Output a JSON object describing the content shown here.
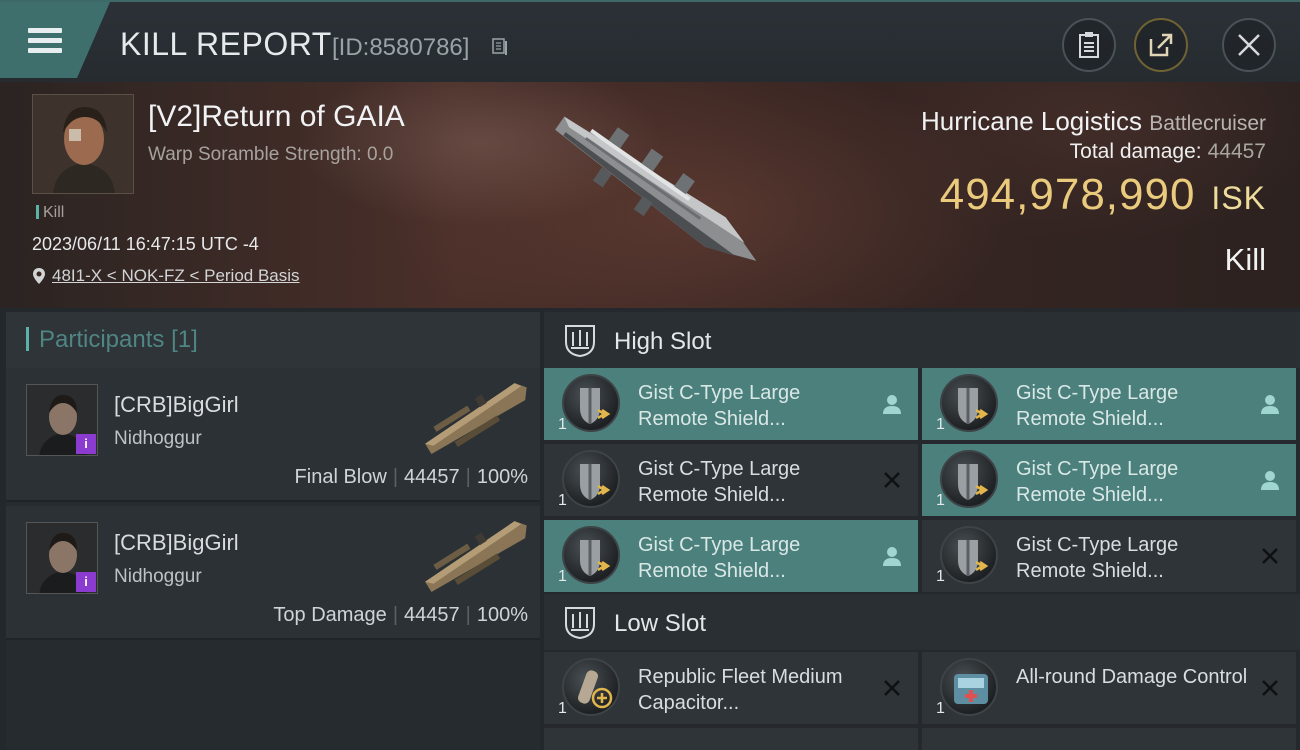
{
  "header": {
    "title": "KILL REPORT",
    "report_id": "[ID:8580786]",
    "icons": {
      "menu": "hamburger-icon",
      "copy": "copy-icon",
      "clipboard": "clipboard-icon",
      "share": "share-icon",
      "close": "close-icon"
    }
  },
  "victim": {
    "name": "[V2]Return of GAIA",
    "warp_scramble": "Warp Soramble Strength: 0.0",
    "tag": "Kill",
    "timestamp": "2023/06/11 16:47:15 UTC -4",
    "location": "48I1-X < NOK-FZ < Period Basis"
  },
  "ship": {
    "name": "Hurricane Logistics",
    "class": "Battlecruiser",
    "total_damage_label": "Total damage:",
    "total_damage": "44457",
    "isk_value": "494,978,990",
    "isk_unit": "ISK",
    "result": "Kill"
  },
  "participants": {
    "title": "Participants",
    "count": "[1]",
    "rows": [
      {
        "name": "[CRB]BigGirl",
        "ship": "Nidhoggur",
        "role": "Final Blow",
        "damage": "44457",
        "percent": "100%",
        "badge": "i"
      },
      {
        "name": "[CRB]BigGirl",
        "ship": "Nidhoggur",
        "role": "Top Damage",
        "damage": "44457",
        "percent": "100%",
        "badge": "i"
      }
    ]
  },
  "fitting": {
    "high_slot": {
      "title": "High Slot",
      "modules": [
        {
          "name": "Gist C-Type Large Remote Shield...",
          "qty": "1",
          "status": "person",
          "active": true
        },
        {
          "name": "Gist C-Type Large Remote Shield...",
          "qty": "1",
          "status": "person",
          "active": true
        },
        {
          "name": "Gist C-Type Large Remote Shield...",
          "qty": "1",
          "status": "x",
          "active": false
        },
        {
          "name": "Gist C-Type Large Remote Shield...",
          "qty": "1",
          "status": "person",
          "active": true
        },
        {
          "name": "Gist C-Type Large Remote Shield...",
          "qty": "1",
          "status": "person",
          "active": true
        },
        {
          "name": "Gist C-Type Large Remote Shield...",
          "qty": "1",
          "status": "x",
          "active": false
        }
      ]
    },
    "low_slot": {
      "title": "Low Slot",
      "modules": [
        {
          "name": "Republic Fleet Medium Capacitor...",
          "qty": "1",
          "status": "x",
          "active": false
        },
        {
          "name": "All-round Damage Control",
          "qty": "1",
          "status": "x",
          "active": false
        }
      ]
    }
  },
  "colors": {
    "accent": "#4b807c",
    "isk": "#eacb7d",
    "purple_badge": "#8b3bd0"
  }
}
